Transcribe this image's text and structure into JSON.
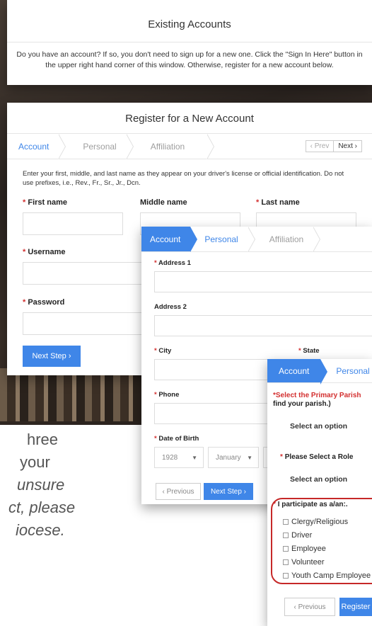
{
  "existing": {
    "title": "Existing Accounts",
    "text": "Do you have an account? If so, you don't need to sign up for a new one. Click the \"Sign In Here\" button in the upper right hand corner of this window. Otherwise, register for a new account below."
  },
  "register": {
    "title": "Register for a New Account",
    "tabs": [
      "Account",
      "Personal",
      "Affiliation"
    ],
    "prev": "‹ Prev",
    "next": "Next ›",
    "instructions": "Enter your first, middle, and last name as they appear on your driver's license or official identification. Do not use prefixes, i.e., Rev., Fr., Sr., Jr., Dcn.",
    "first_name": "First name",
    "middle_name": "Middle name",
    "last_name": "Last name",
    "username": "Username",
    "password": "Password",
    "next_step": "Next Step ›"
  },
  "personal": {
    "tabs": [
      "Account",
      "Personal",
      "Affiliation"
    ],
    "address1": "Address 1",
    "address2": "Address 2",
    "city": "City",
    "state": "State",
    "phone": "Phone",
    "dob": "Date of Birth",
    "dob_year": "1928",
    "dob_month": "January",
    "previous": "‹ Previous",
    "next_step": "Next Step ›"
  },
  "affiliation": {
    "tabs": [
      "Account",
      "Personal"
    ],
    "parish_label": "*Select the Primary Parish",
    "parish_label2": "find your parish.)",
    "parish_value": "Select an option",
    "role_label": "Please Select a Role",
    "role_value": "Select an option",
    "participate_label": "I participate as a/an:.",
    "options": [
      "Clergy/Religious",
      "Driver",
      "Employee",
      "Volunteer",
      "Youth Camp Employee"
    ],
    "previous": "‹ Previous",
    "register": "Register"
  },
  "caption": {
    "line1": "hree",
    "line2": "your",
    "line3": "unsure",
    "line4": "ct, please",
    "line5": "iocese."
  },
  "required_mark": "*"
}
